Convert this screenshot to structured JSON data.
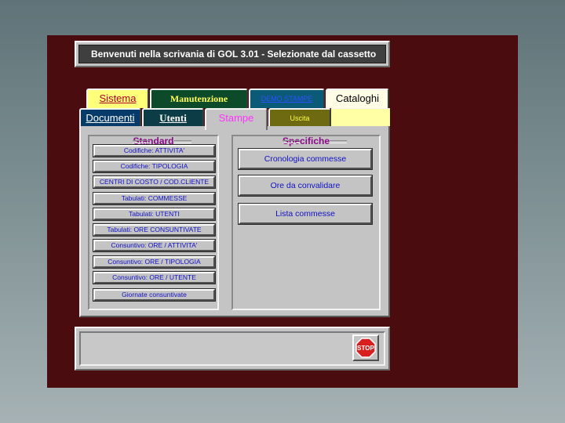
{
  "window": {
    "title": "Benvenuti nella scrivania di GOL 3.01 - Selezionate dal cassetto"
  },
  "tabs": {
    "row1": [
      {
        "id": "sistema",
        "label": "Sistema"
      },
      {
        "id": "manutenzione",
        "label": "Manutenzione"
      },
      {
        "id": "demo",
        "label": "DEMO STAMPE"
      },
      {
        "id": "cataloghi",
        "label": "Cataloghi"
      }
    ],
    "row2": [
      {
        "id": "documenti",
        "label": "Documenti"
      },
      {
        "id": "utenti",
        "label": "Utenti"
      },
      {
        "id": "stampe",
        "label": "Stampe",
        "active": true
      },
      {
        "id": "uscita",
        "label": "Uscita"
      }
    ]
  },
  "standard": {
    "title": "Standard",
    "buttons": [
      "Codifiche: ATTIVITA'",
      "Codifiche: TIPOLOGIA",
      "CENTRI DI COSTO / COD.CLIENTE",
      "Tabulati: COMMESSE",
      "Tabulati: UTENTI",
      "Tabulati: ORE CONSUNTIVATE",
      "Consuntivo: ORE / ATTIVITA'",
      "Consuntivo: ORE / TIPOLOGIA",
      "Consuntivo: ORE / UTENTE",
      "Giornate consuntivate"
    ]
  },
  "specifiche": {
    "title": "Specifiche",
    "buttons": [
      "Cronologia commesse",
      "Ore da convalidare",
      "Lista commesse"
    ]
  },
  "stop": {
    "label": "STOP",
    "icon": "stop-sign-icon"
  },
  "colors": {
    "window_bg": "#4a0c0e",
    "panel_bg": "#c4c4c4",
    "button_text": "#1010c8",
    "group_title": "#8a0a8a",
    "stop_red": "#d81e1e"
  }
}
